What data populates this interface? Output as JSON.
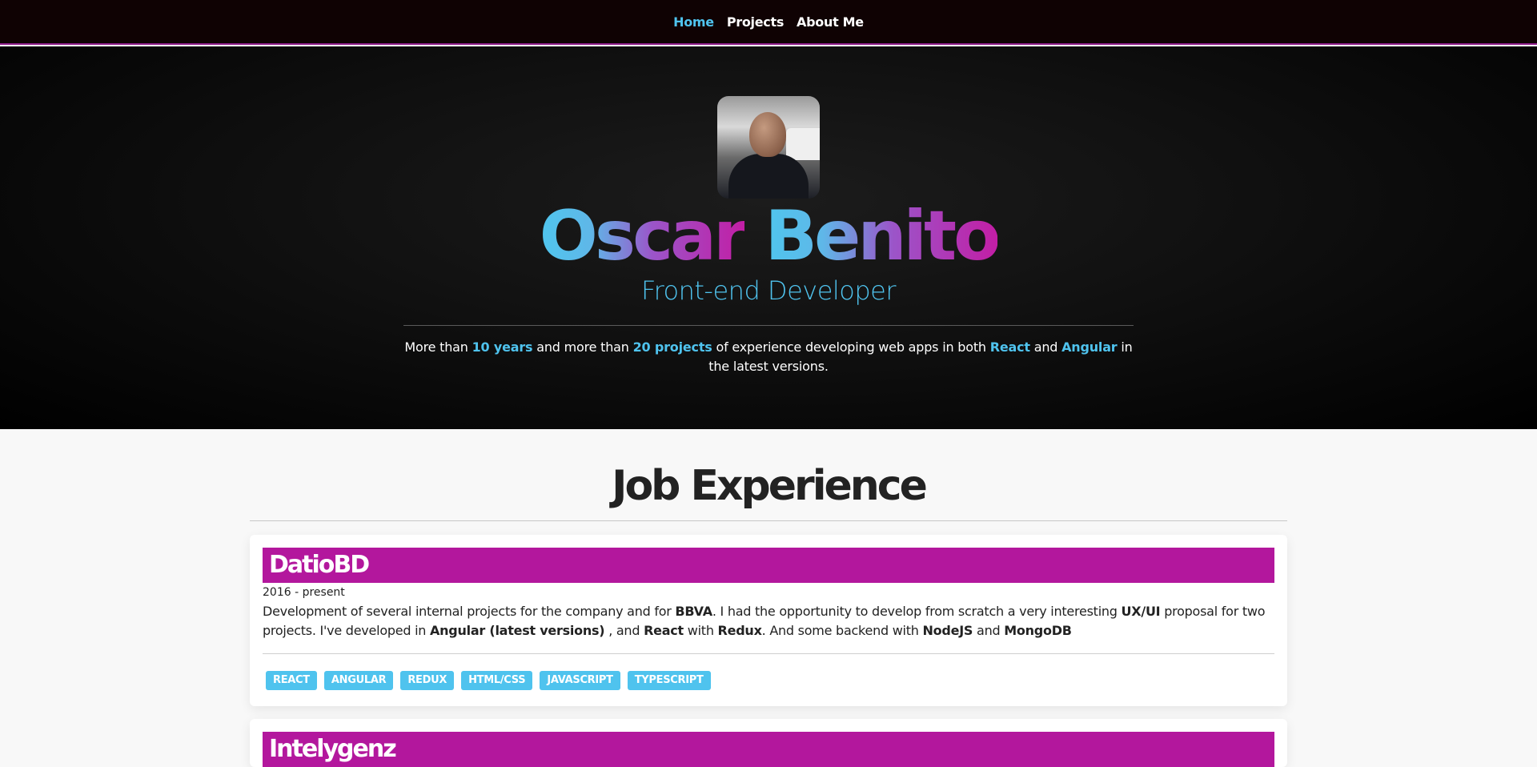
{
  "nav": {
    "items": [
      {
        "label": "Home",
        "active": true
      },
      {
        "label": "Projects",
        "active": false
      },
      {
        "label": "About Me",
        "active": false
      }
    ]
  },
  "hero": {
    "avatar_alt": "profile photo",
    "first_name": "Oscar",
    "last_name": "Benito",
    "role": "Front-end Developer",
    "intro": {
      "t1": "More than ",
      "b1": "10 years",
      "t2": " and more than ",
      "b2": "20 projects",
      "t3": " of experience developing web apps in both ",
      "b3": "React",
      "t4": " and ",
      "b4": "Angular",
      "t5": " in the latest versions."
    }
  },
  "jobs": {
    "title": "Job Experience",
    "items": [
      {
        "company": "DatioBD",
        "period": "2016 - present",
        "desc": {
          "t1": "Development of several internal projects for the company and for ",
          "b1": "BBVA",
          "t2": ". I had the opportunity to develop from scratch a very interesting ",
          "b2": "UX/UI",
          "t3": " proposal for two projects. I've developed in ",
          "b3": "Angular (latest versions)",
          "t4": " , and ",
          "b4": "React",
          "t5": " with ",
          "b5": "Redux",
          "t6": ". And some backend with ",
          "b6": "NodeJS",
          "t7": " and ",
          "b7": "MongoDB"
        },
        "tags": [
          "REACT",
          "ANGULAR",
          "REDUX",
          "HTML/CSS",
          "JAVASCRIPT",
          "TYPESCRIPT"
        ]
      },
      {
        "company": "Intelygenz"
      }
    ]
  },
  "colors": {
    "accent": "#4fc3ee",
    "magenta": "#b3179d",
    "nav_bg": "#0f0203"
  }
}
